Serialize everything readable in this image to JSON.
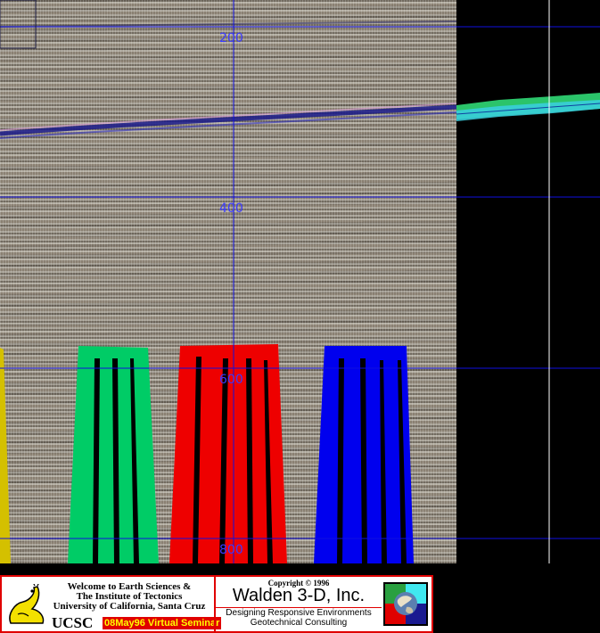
{
  "viewport": {
    "depth_labels": [
      "200",
      "400",
      "600",
      "800"
    ],
    "colors": {
      "grid_line": "#1010e0",
      "tick_label": "#3a3aff",
      "well_yellow": "#d4c000",
      "well_green": "#00cc66",
      "well_red": "#ee0000",
      "well_blue": "#0000ee",
      "horizon_green": "#2bc46a",
      "horizon_cyan": "#3ad0e0"
    }
  },
  "banner": {
    "welcome_line1": "Welcome to Earth Sciences &",
    "welcome_line2": "The Institute of Tectonics",
    "welcome_line3": "University of California, Santa Cruz",
    "ucsc": "UCSC",
    "seminar": "08May96 Virtual Seminar",
    "copyright": "Copyright © 1996",
    "company": "Walden 3-D, Inc.",
    "tagline1": "Designing Responsive Environments",
    "tagline2": "Geotechnical Consulting",
    "colors": {
      "border": "#e00000",
      "seminar_bg": "#e00000",
      "seminar_text": "#ffff00"
    }
  }
}
